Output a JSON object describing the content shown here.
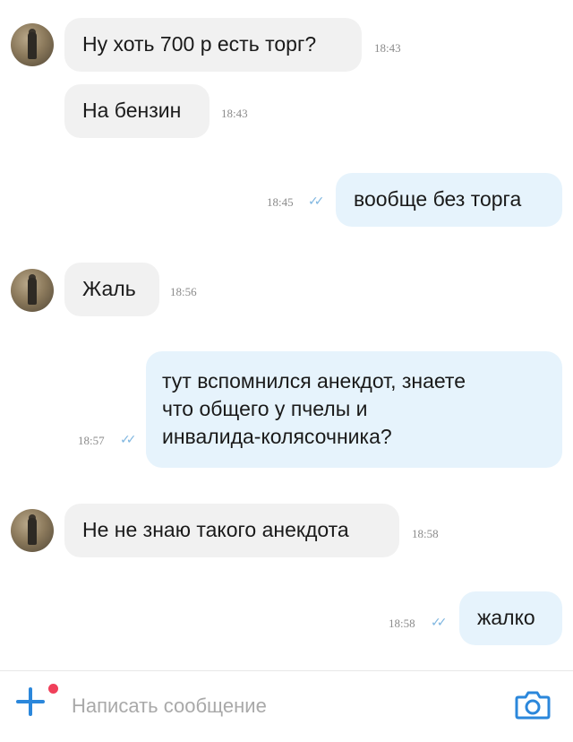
{
  "messages": [
    {
      "dir": "in",
      "text": "Ну хоть 700 р есть торг?",
      "time": "18:43"
    },
    {
      "dir": "in",
      "text": "На бензин",
      "time": "18:43"
    },
    {
      "dir": "out",
      "text": "вообще без торга",
      "time": "18:45"
    },
    {
      "dir": "in",
      "text": "Жаль",
      "time": "18:56"
    },
    {
      "dir": "out",
      "lines": [
        "тут вспомнился анекдот, знаете",
        "что общего у пчелы и",
        "инвалида-колясочника?"
      ],
      "time": "18:57"
    },
    {
      "dir": "in",
      "text": "Не не знаю такого анекдота",
      "time": "18:58"
    },
    {
      "dir": "out",
      "text": "жалко",
      "time": "18:58"
    }
  ],
  "composer": {
    "placeholder": "Написать сообщение",
    "attach_icon": "plus-icon",
    "camera_icon": "camera-icon"
  },
  "colors": {
    "incoming_bubble": "#f1f1f1",
    "outgoing_bubble": "#e6f3fc",
    "accent": "#2b87db",
    "badge": "#f0405a"
  }
}
